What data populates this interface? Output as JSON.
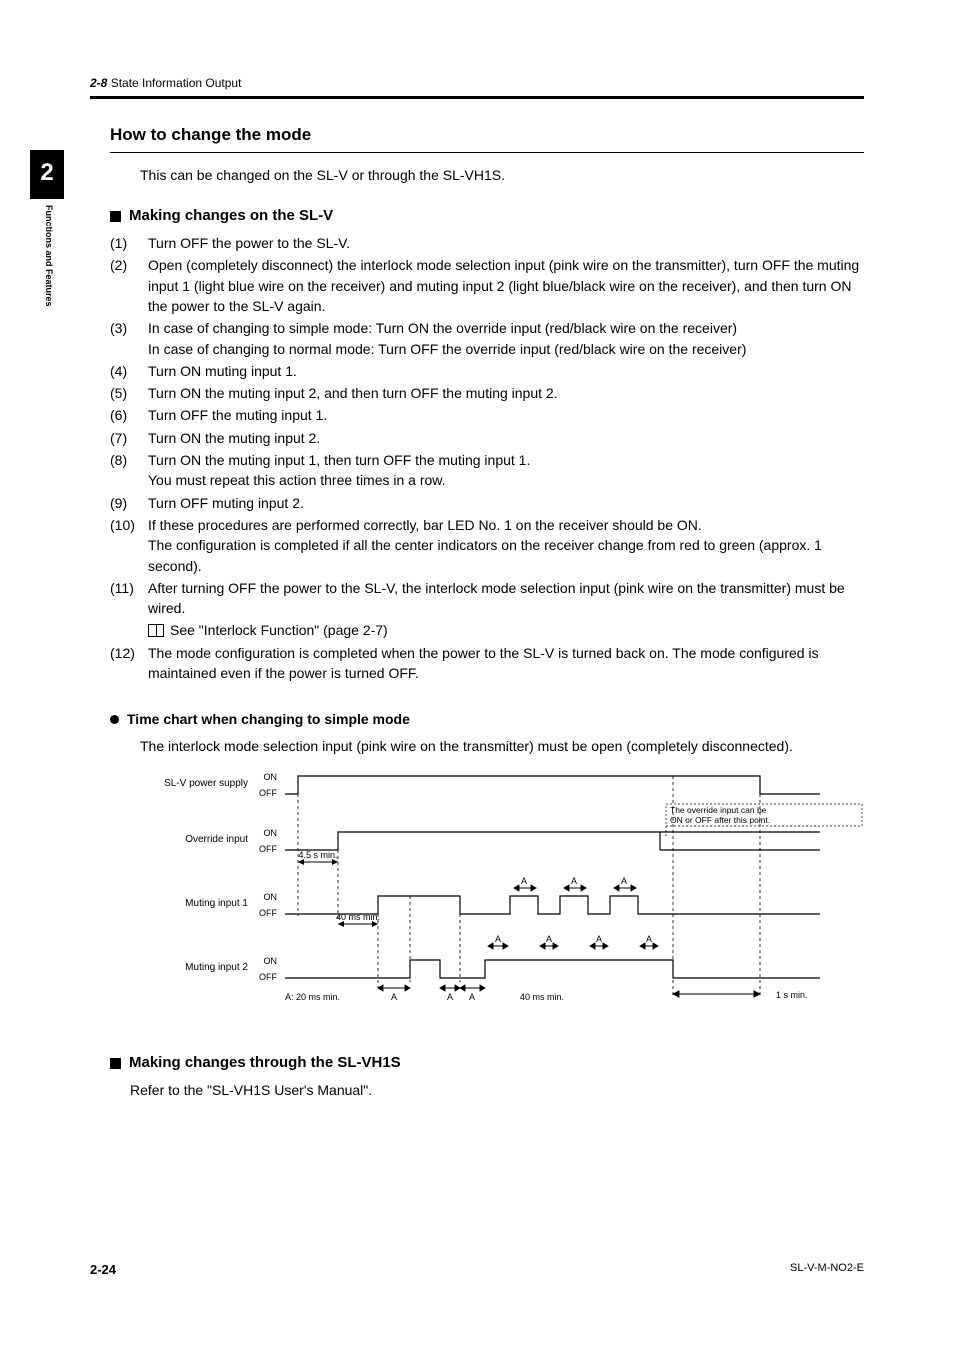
{
  "header": {
    "section_num": "2-8",
    "section_title": "State Information Output"
  },
  "chapter": {
    "num": "2",
    "label": "Functions and Features"
  },
  "h1": "How to change the mode",
  "intro": "This can be changed on the SL-V or through the SL-VH1S.",
  "h2a": "Making changes on the SL-V",
  "steps": [
    {
      "n": "(1)",
      "t": "Turn OFF the power to the SL-V."
    },
    {
      "n": "(2)",
      "t": "Open (completely disconnect) the interlock mode selection input (pink wire on the transmitter), turn OFF the muting input 1 (light blue wire on the receiver) and muting input 2 (light blue/black wire on the receiver), and then turn ON the power to the SL-V again."
    },
    {
      "n": "(3)",
      "t": "In case of changing to simple mode: Turn ON the override input (red/black wire on the receiver)\nIn case of changing to normal mode: Turn OFF the override input (red/black wire on the receiver)"
    },
    {
      "n": "(4)",
      "t": "Turn ON muting input 1."
    },
    {
      "n": "(5)",
      "t": "Turn ON the muting input 2, and then turn OFF the muting input 2."
    },
    {
      "n": "(6)",
      "t": "Turn OFF the muting input 1."
    },
    {
      "n": "(7)",
      "t": "Turn ON the muting input 2."
    },
    {
      "n": "(8)",
      "t": "Turn ON the muting input 1, then turn OFF the muting input 1.\nYou must repeat this action three times in a row."
    },
    {
      "n": "(9)",
      "t": "Turn OFF muting input 2."
    },
    {
      "n": "(10)",
      "t": "If these procedures are performed correctly, bar LED No. 1 on the receiver should be ON.\nThe configuration is completed if all the center indicators on the receiver change from red to green (approx. 1 second)."
    },
    {
      "n": "(11)",
      "t": "After turning OFF the power to the SL-V, the interlock mode selection input (pink wire on the transmitter) must be wired.",
      "xref": "See \"Interlock Function\" (page 2-7)"
    },
    {
      "n": "(12)",
      "t": "The mode configuration is completed when the power to the SL-V is turned back on. The mode configured is maintained even if the power is turned OFF."
    }
  ],
  "h3": "Time chart when changing to simple mode",
  "p3": "The interlock mode selection input (pink wire on the transmitter) must be open (completely disconnected).",
  "chart": {
    "rows": [
      {
        "label": "SL-V power supply"
      },
      {
        "label": "Override input"
      },
      {
        "label": "Muting input 1"
      },
      {
        "label": "Muting input 2"
      }
    ],
    "on": "ON",
    "off": "OFF",
    "note_override": "The override input can be ON or OFF after this point.",
    "t_4_5s": "4.5 s min.",
    "t_40ms": "40 ms min.",
    "t_40ms_b": "40 ms min.",
    "t_1s": "1 s min.",
    "a": "A",
    "a_legend": "A: 20 ms min."
  },
  "h2b": "Making changes through the SL-VH1S",
  "p2b": "Refer to the \"SL-VH1S User's Manual\".",
  "footer": {
    "page": "2-24",
    "doc": "SL-V-M-NO2-E"
  },
  "chart_data": {
    "type": "timing-diagram",
    "title": "Time chart when changing to simple mode",
    "signals": [
      {
        "name": "SL-V power supply",
        "segments": [
          [
            "OFF",
            0,
            10
          ],
          [
            "ON",
            10,
            560
          ],
          [
            "OFF",
            560,
            600
          ]
        ]
      },
      {
        "name": "Override input",
        "segments": [
          [
            "OFF",
            0,
            60
          ],
          [
            "ON",
            60,
            480
          ],
          [
            "OFF-or-ON",
            480,
            600
          ]
        ],
        "note": "The override input can be ON or OFF after this point."
      },
      {
        "name": "Muting input 1",
        "segments": [
          [
            "OFF",
            0,
            120
          ],
          [
            "ON",
            120,
            220
          ],
          [
            "OFF",
            220,
            280
          ],
          [
            "ON",
            280,
            310
          ],
          [
            "OFF",
            310,
            340
          ],
          [
            "ON",
            340,
            370
          ],
          [
            "OFF",
            370,
            400
          ],
          [
            "ON",
            400,
            430
          ],
          [
            "OFF",
            430,
            600
          ]
        ]
      },
      {
        "name": "Muting input 2",
        "segments": [
          [
            "OFF",
            0,
            160
          ],
          [
            "ON",
            160,
            190
          ],
          [
            "OFF",
            190,
            250
          ],
          [
            "ON",
            250,
            520
          ],
          [
            "OFF",
            520,
            600
          ]
        ]
      }
    ],
    "annotations": [
      {
        "text": "4.5 s min.",
        "between": [
          "SL-V power supply ON",
          "Override input ON"
        ]
      },
      {
        "text": "40 ms min.",
        "between": [
          "Override input ON",
          "Muting input 1 first ON"
        ]
      },
      {
        "text": "A (20 ms min.)",
        "applies_to": "toggle gaps on Muting input 1 and Muting input 2"
      },
      {
        "text": "40 ms min.",
        "between": [
          "Muting input 2 rising edges"
        ]
      },
      {
        "text": "1 s min.",
        "between": [
          "Muting input 2 final OFF",
          "SL-V power supply OFF"
        ]
      }
    ],
    "legend": "A: 20 ms min."
  }
}
